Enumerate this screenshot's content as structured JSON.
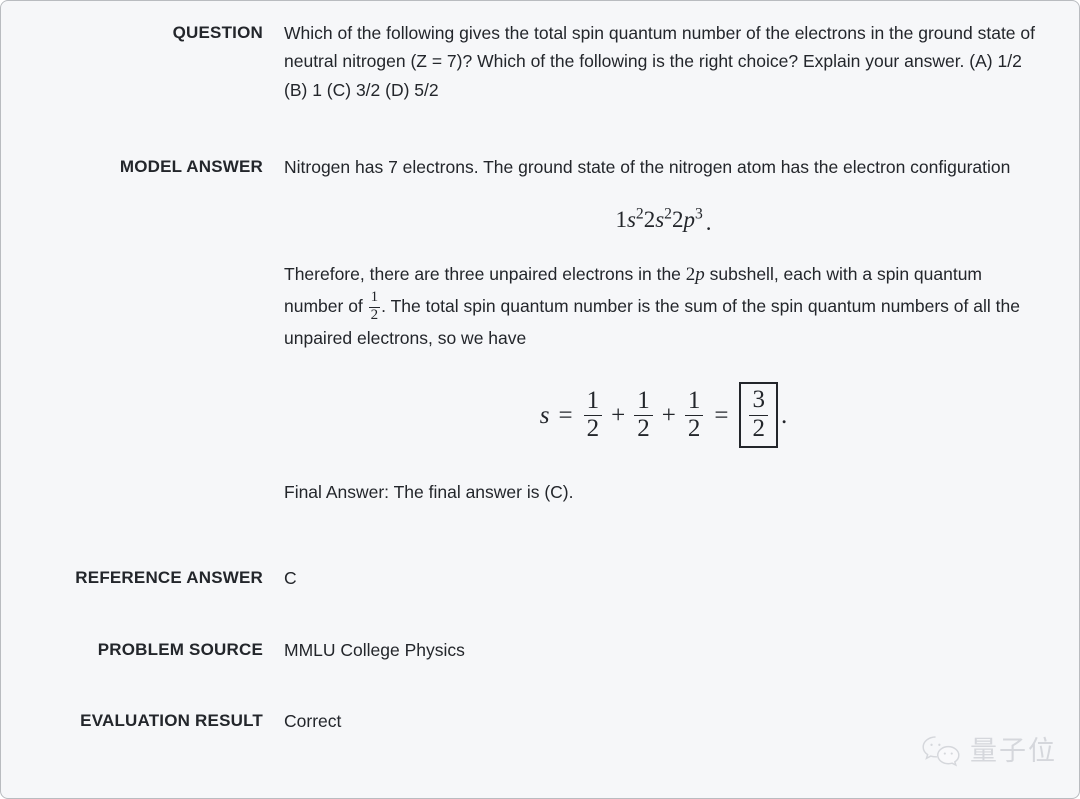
{
  "card": {
    "background": "#f6f7f9",
    "border_color": "#b9bcc0",
    "text_color": "#23262b"
  },
  "rows": {
    "question": {
      "label": "QUESTION",
      "text": "Which of the following gives the total spin quantum number of the electrons in the ground state of neutral nitrogen (Z = 7)? Which of the following is the right choice? Explain your answer. (A) 1/2 (B) 1 (C) 3/2 (D) 5/2"
    },
    "model_answer": {
      "label": "MODEL ANSWER",
      "paragraph_1": "Nitrogen has 7 electrons. The ground state of the nitrogen atom has the electron configuration",
      "equation_config": {
        "latex": "1s^2 2s^2 2p^3.",
        "parts": [
          {
            "num": "1",
            "var": "s",
            "exp": "2"
          },
          {
            "num": "2",
            "var": "s",
            "exp": "2"
          },
          {
            "num": "2",
            "var": "p",
            "exp": "3"
          }
        ],
        "trailing": "."
      },
      "paragraph_2_a": "Therefore, there are three unpaired electrons in the ",
      "inline_math_2p": {
        "num": "2",
        "var": "p"
      },
      "paragraph_2_b": " subshell, each with a spin quantum number of ",
      "inline_fraction_half": {
        "numerator": "1",
        "denominator": "2"
      },
      "paragraph_2_c": ". The total spin quantum number is the sum of the spin quantum numbers of all the unpaired electrons, so we have",
      "equation_sum": {
        "latex": "s = \\frac{1}{2} + \\frac{1}{2} + \\frac{1}{2} = \\boxed{\\frac{3}{2}}.",
        "variable": "s",
        "equals": "=",
        "plus": "+",
        "terms": [
          {
            "numerator": "1",
            "denominator": "2"
          },
          {
            "numerator": "1",
            "denominator": "2"
          },
          {
            "numerator": "1",
            "denominator": "2"
          }
        ],
        "boxed_result": {
          "numerator": "3",
          "denominator": "2"
        },
        "trailing": "."
      },
      "final_answer": "Final Answer: The final answer is (C)."
    },
    "reference_answer": {
      "label": "REFERENCE ANSWER",
      "value": "C"
    },
    "problem_source": {
      "label": "PROBLEM SOURCE",
      "value": "MMLU College Physics"
    },
    "evaluation_result": {
      "label": "EVALUATION RESULT",
      "value": "Correct"
    }
  },
  "watermark": {
    "icon": "wechat-icon",
    "text": "量子位",
    "color": "#c9ccd1"
  }
}
